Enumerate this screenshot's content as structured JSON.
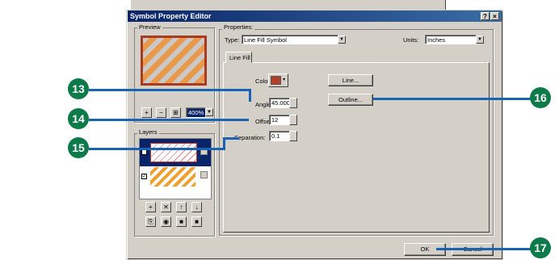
{
  "window": {
    "title": "Symbol Property Editor",
    "help_btn": "?",
    "close_btn": "×"
  },
  "preview": {
    "group_label": "Preview",
    "zoom_in": "+",
    "zoom_out": "−",
    "fit": "⊞",
    "zoom_value": "400%"
  },
  "layers": {
    "group_label": "Layers",
    "tools_row1": [
      "+",
      "✕",
      "↑",
      "↓"
    ],
    "tools_row2": [
      "⎘",
      "◉",
      "■",
      "■"
    ]
  },
  "properties": {
    "group_label": "Properties:",
    "type_label": "Type:",
    "type_value": "Line Fill Symbol",
    "units_label": "Units:",
    "units_value": "Inches",
    "tab_label": "Line Fill",
    "color_label": "Color:",
    "color_value": "#b0402a",
    "angle_label": "Angle:",
    "angle_value": "45.000",
    "offset_label": "Offset:",
    "offset_value": "12",
    "separation_label": "Separation:",
    "separation_value": "0.1",
    "line_button": "Line...",
    "outline_button": "Outline..."
  },
  "footer": {
    "ok": "OK",
    "cancel": "Cancel"
  },
  "callouts": [
    "13",
    "14",
    "15",
    "16",
    "17"
  ]
}
